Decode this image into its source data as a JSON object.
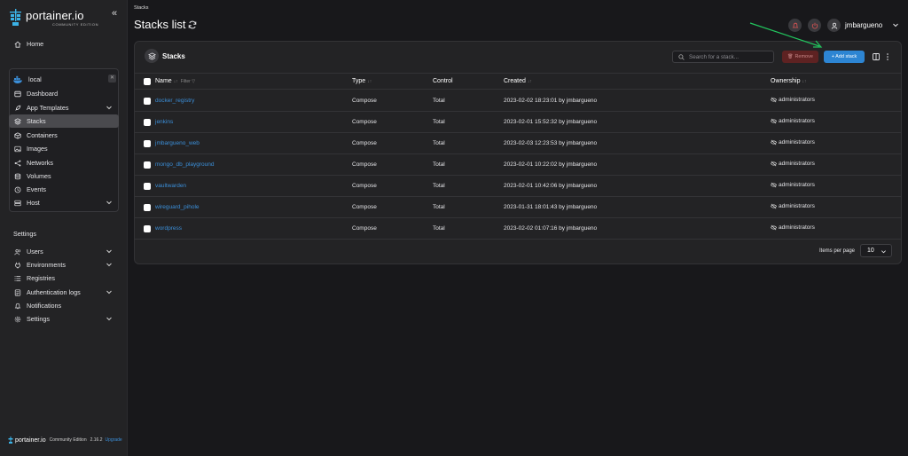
{
  "app": {
    "logo_text": "portainer.io",
    "logo_sub": "COMMUNITY EDITION",
    "accent": "#2d85d3",
    "danger": "#5e2222"
  },
  "sidebar": {
    "home": "Home",
    "environment": {
      "name": "local",
      "items": [
        {
          "label": "Dashboard",
          "icon": "dashboard-icon"
        },
        {
          "label": "App Templates",
          "icon": "rocket-icon",
          "expandable": true
        },
        {
          "label": "Stacks",
          "icon": "stacks-icon",
          "active": true
        },
        {
          "label": "Containers",
          "icon": "box-icon"
        },
        {
          "label": "Images",
          "icon": "image-icon"
        },
        {
          "label": "Networks",
          "icon": "network-icon"
        },
        {
          "label": "Volumes",
          "icon": "database-icon"
        },
        {
          "label": "Events",
          "icon": "clock-icon"
        },
        {
          "label": "Host",
          "icon": "server-icon",
          "expandable": true
        }
      ]
    },
    "settings_heading": "Settings",
    "settings_items": [
      {
        "label": "Users",
        "icon": "users-icon",
        "expandable": true
      },
      {
        "label": "Environments",
        "icon": "plug-icon",
        "expandable": true
      },
      {
        "label": "Registries",
        "icon": "list-icon"
      },
      {
        "label": "Authentication logs",
        "icon": "log-icon",
        "expandable": true
      },
      {
        "label": "Notifications",
        "icon": "bell-icon"
      },
      {
        "label": "Settings",
        "icon": "gear-icon",
        "expandable": true
      }
    ],
    "footer": {
      "logo": "portainer.io",
      "edition": "Community Edition",
      "version": "2.16.2",
      "upgrade": "Upgrade"
    }
  },
  "header": {
    "breadcrumb": "Stacks",
    "title": "Stacks list",
    "user": "jmbargueno"
  },
  "panel": {
    "title": "Stacks",
    "search_placeholder": "Search for a stack...",
    "remove_label": "Remove",
    "add_label": "+ Add stack",
    "columns": {
      "name": "Name",
      "filter": "Filter",
      "type": "Type",
      "control": "Control",
      "created": "Created",
      "ownership": "Ownership"
    },
    "rows": [
      {
        "name": "docker_registry",
        "type": "Compose",
        "control": "Total",
        "created": "2023-02-02 18:23:01 by jmbargueno",
        "ownership": "administrators"
      },
      {
        "name": "jenkins",
        "type": "Compose",
        "control": "Total",
        "created": "2023-02-01 15:52:32 by jmbargueno",
        "ownership": "administrators"
      },
      {
        "name": "jmbargueno_web",
        "type": "Compose",
        "control": "Total",
        "created": "2023-02-03 12:23:53 by jmbargueno",
        "ownership": "administrators"
      },
      {
        "name": "mongo_db_playground",
        "type": "Compose",
        "control": "Total",
        "created": "2023-02-01 10:22:02 by jmbargueno",
        "ownership": "administrators"
      },
      {
        "name": "vaultwarden",
        "type": "Compose",
        "control": "Total",
        "created": "2023-02-01 10:42:06 by jmbargueno",
        "ownership": "administrators"
      },
      {
        "name": "wireguard_pihole",
        "type": "Compose",
        "control": "Total",
        "created": "2023-01-31 18:01:43 by jmbargueno",
        "ownership": "administrators"
      },
      {
        "name": "wordpress",
        "type": "Compose",
        "control": "Total",
        "created": "2023-02-02 01:07:16 by jmbargueno",
        "ownership": "administrators"
      }
    ],
    "pagination": {
      "label": "Items per page",
      "value": "10"
    }
  }
}
